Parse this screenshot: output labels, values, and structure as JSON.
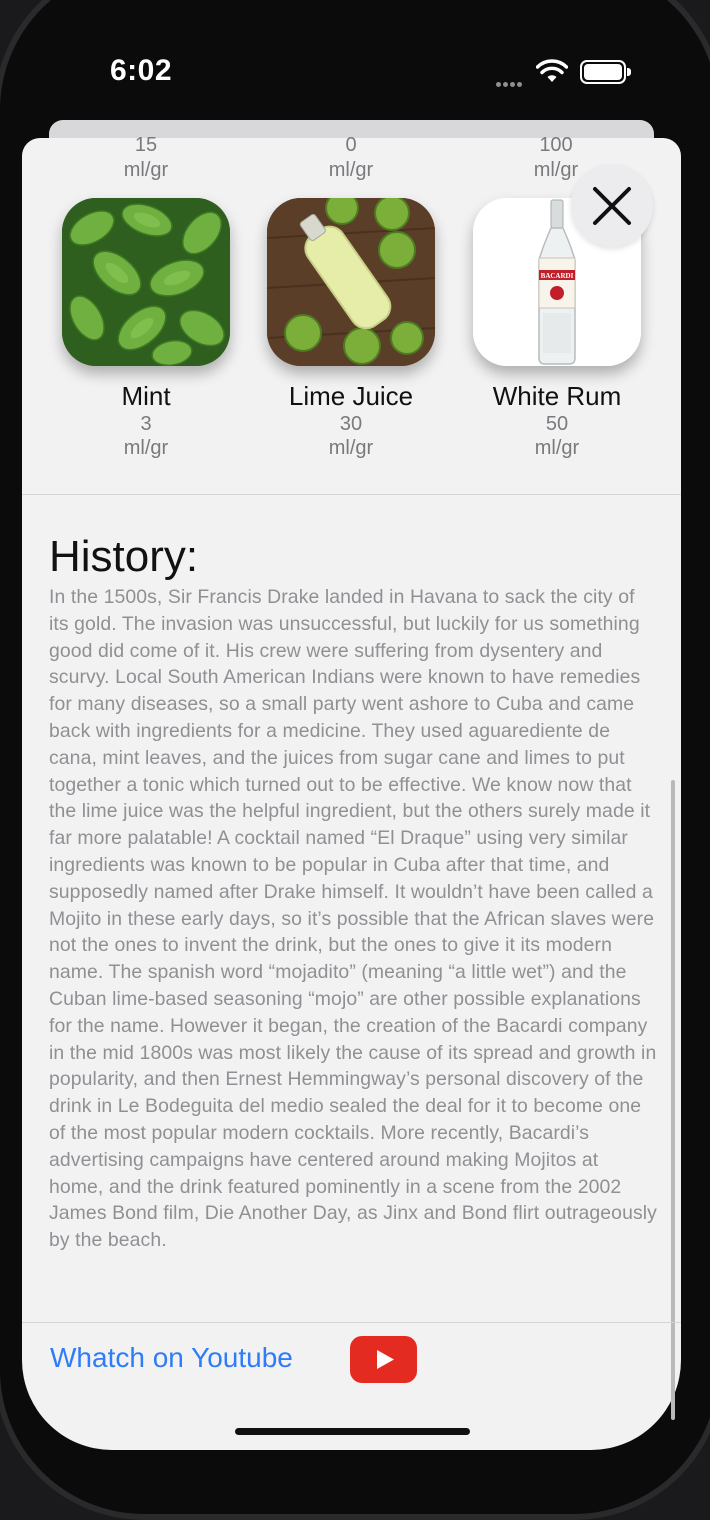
{
  "status_bar": {
    "time": "6:02"
  },
  "previous_row": [
    {
      "amount": "15",
      "unit": "ml/gr"
    },
    {
      "amount": "0",
      "unit": "ml/gr"
    },
    {
      "amount": "100",
      "unit": "ml/gr"
    }
  ],
  "ingredients": [
    {
      "name": "Mint",
      "amount": "3",
      "unit": "ml/gr",
      "icon": "mint-leaves-photo"
    },
    {
      "name": "Lime Juice",
      "amount": "30",
      "unit": "ml/gr",
      "icon": "lime-juice-bottle-photo"
    },
    {
      "name": "White Rum",
      "amount": "50",
      "unit": "ml/gr",
      "icon": "bacardi-rum-bottle-photo"
    }
  ],
  "bottle_label": "BACARDI",
  "history": {
    "title": "History:",
    "text": "In the 1500s, Sir Francis Drake landed in Havana to sack the city of its gold. The invasion was unsuccessful, but luckily for us something good did come of it. His crew were suffering from dysentery and scurvy. Local South American Indians were known to have remedies for many diseases, so a small party went ashore to Cuba and came back with ingredients for a medicine. They used aguarediente de cana, mint leaves, and the juices from sugar cane and limes to put together a tonic which turned out to be effective. We know now that the lime juice was the helpful ingredient, but the others surely made it far more palatable! A cocktail named “El Draque” using very similar ingredients was known to be popular in Cuba after that time, and supposedly named after Drake himself.  It wouldn’t have been called a Mojito in these early days, so it’s possible that the African slaves were not the ones to invent the drink, but the ones to give it its modern name. The spanish word “mojadito” (meaning “a little wet”) and the Cuban lime-based seasoning “mojo” are other possible explanations for the name. However it began, the creation of the Bacardi company in the mid 1800s was most likely the cause of its spread and growth in popularity, and then Ernest Hemmingway’s personal discovery of the drink in Le Bodeguita del medio sealed the deal for it to become one of the most popular modern cocktails. More recently, Bacardi’s advertising campaigns have centered around making Mojitos at home, and the drink featured pominently in a scene from the 2002 James Bond film, Die Another Day, as Jinx and Bond flirt outrageously by the beach."
  },
  "footer": {
    "youtube_label": "Whatch on Youtube",
    "youtube_color": "#e42b22",
    "link_color": "#2f7cf6"
  },
  "close_icon": "close-icon"
}
